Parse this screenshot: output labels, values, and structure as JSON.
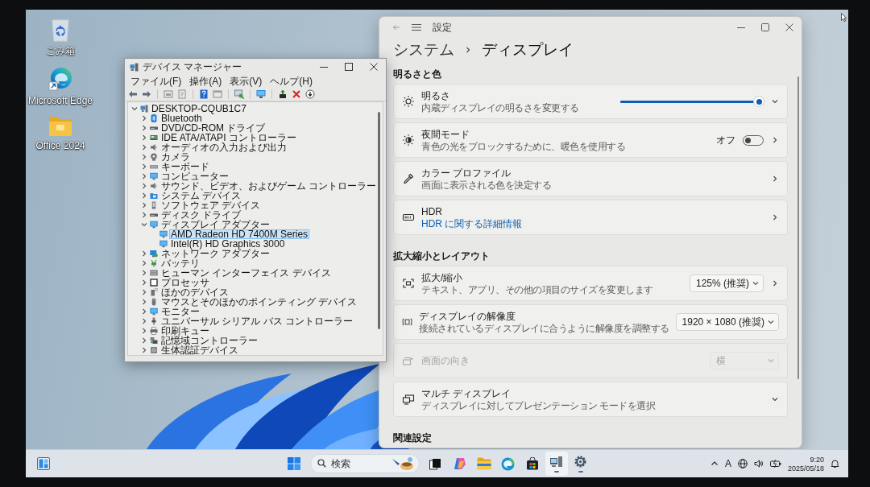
{
  "desktop_icons": [
    {
      "label": "ごみ箱"
    },
    {
      "label": "Microsoft Edge"
    },
    {
      "label": "Office 2024"
    }
  ],
  "device_manager": {
    "title": "デバイス マネージャー",
    "menu": [
      "ファイル(F)",
      "操作(A)",
      "表示(V)",
      "ヘルプ(H)"
    ],
    "tree": [
      {
        "label": "DESKTOP-CQUB1C7",
        "expanded": true,
        "selected": false,
        "children": [
          {
            "label": "Bluetooth",
            "expanded": false,
            "selected": false
          },
          {
            "label": "DVD/CD-ROM ドライブ",
            "expanded": false,
            "selected": false
          },
          {
            "label": "IDE ATA/ATAPI コントローラー",
            "expanded": false,
            "selected": false
          },
          {
            "label": "オーディオの入力および出力",
            "expanded": false,
            "selected": false
          },
          {
            "label": "カメラ",
            "expanded": false,
            "selected": false
          },
          {
            "label": "キーボード",
            "expanded": false,
            "selected": false
          },
          {
            "label": "コンピューター",
            "expanded": false,
            "selected": false
          },
          {
            "label": "サウンド、ビデオ、およびゲーム コントローラー",
            "expanded": false,
            "selected": false
          },
          {
            "label": "システム デバイス",
            "expanded": false,
            "selected": false
          },
          {
            "label": "ソフトウェア デバイス",
            "expanded": false,
            "selected": false
          },
          {
            "label": "ディスク ドライブ",
            "expanded": false,
            "selected": false
          },
          {
            "label": "ディスプレイ アダプター",
            "expanded": true,
            "selected": false,
            "children": [
              {
                "label": "AMD Radeon HD 7400M Series",
                "selected": true
              },
              {
                "label": "Intel(R) HD Graphics 3000",
                "selected": false
              }
            ]
          },
          {
            "label": "ネットワーク アダプター",
            "expanded": false,
            "selected": false
          },
          {
            "label": "バッテリ",
            "expanded": false,
            "selected": false
          },
          {
            "label": "ヒューマン インターフェイス デバイス",
            "expanded": false,
            "selected": false
          },
          {
            "label": "プロセッサ",
            "expanded": false,
            "selected": false
          },
          {
            "label": "ほかのデバイス",
            "expanded": false,
            "selected": false
          },
          {
            "label": "マウスとそのほかのポインティング デバイス",
            "expanded": false,
            "selected": false
          },
          {
            "label": "モニター",
            "expanded": false,
            "selected": false
          },
          {
            "label": "ユニバーサル シリアル バス コントローラー",
            "expanded": false,
            "selected": false
          },
          {
            "label": "印刷キュー",
            "expanded": false,
            "selected": false
          },
          {
            "label": "記憶域コントローラー",
            "expanded": false,
            "selected": false
          },
          {
            "label": "生体認証デバイス",
            "expanded": false,
            "selected": false
          }
        ]
      }
    ]
  },
  "settings": {
    "title": "設定",
    "breadcrumb": [
      "システム",
      "ディスプレイ"
    ],
    "sections": [
      {
        "heading": "明るさと色",
        "cards": [
          {
            "kind": "expand",
            "title": "明るさ",
            "description": "内蔵ディスプレイの明るさを変更する",
            "disabled": false,
            "control": {
              "kind": "slider",
              "level": 1
            }
          },
          {
            "kind": "navigate",
            "title": "夜間モード",
            "description": "青色の光をブロックするために、暖色を使用する",
            "disabled": false,
            "control": {
              "kind": "toggle",
              "label": "オフ",
              "on": false
            }
          },
          {
            "kind": "navigate",
            "title": "カラー プロファイル",
            "description": "画面に表示される色を決定する",
            "disabled": false
          },
          {
            "kind": "navigate",
            "title": "HDR",
            "link": "HDR に関する詳細情報",
            "disabled": false
          }
        ]
      },
      {
        "heading": "拡大縮小とレイアウト",
        "cards": [
          {
            "kind": "navigate",
            "title": "拡大/縮小",
            "description": "テキスト、アプリ、その他の項目のサイズを変更します",
            "disabled": false,
            "control": {
              "kind": "dropdown",
              "value": "125% (推奨)"
            }
          },
          {
            "kind": "plain",
            "title": "ディスプレイの解像度",
            "description": "接続されているディスプレイに合うように解像度を調整する",
            "disabled": false,
            "control": {
              "kind": "dropdown",
              "value": "1920 × 1080 (推奨)"
            }
          },
          {
            "kind": "plain",
            "title": "画面の向き",
            "disabled": true,
            "control": {
              "kind": "dropdown",
              "value": "横"
            }
          },
          {
            "kind": "expand",
            "title": "マルチ ディスプレイ",
            "description": "ディスプレイに対してプレゼンテーション モードを選択",
            "disabled": false
          }
        ]
      },
      {
        "heading": "関連設定"
      }
    ]
  },
  "taskbar": {
    "search": {
      "placeholder": "検索"
    },
    "apps": [
      {
        "kind": "start",
        "running": false,
        "active": false
      },
      {
        "kind": "task-view",
        "running": false,
        "active": false
      },
      {
        "kind": "copilot",
        "running": false,
        "active": false
      },
      {
        "kind": "explorer",
        "running": false,
        "active": false
      },
      {
        "kind": "edge",
        "running": false,
        "active": false
      },
      {
        "kind": "store",
        "running": false,
        "active": false
      },
      {
        "kind": "device-manager",
        "running": true,
        "active": true
      },
      {
        "kind": "settings",
        "running": true,
        "active": false
      }
    ],
    "tray": {
      "ime": "A"
    },
    "clock": {
      "time": "9:20",
      "date": "2025/05/18"
    }
  }
}
